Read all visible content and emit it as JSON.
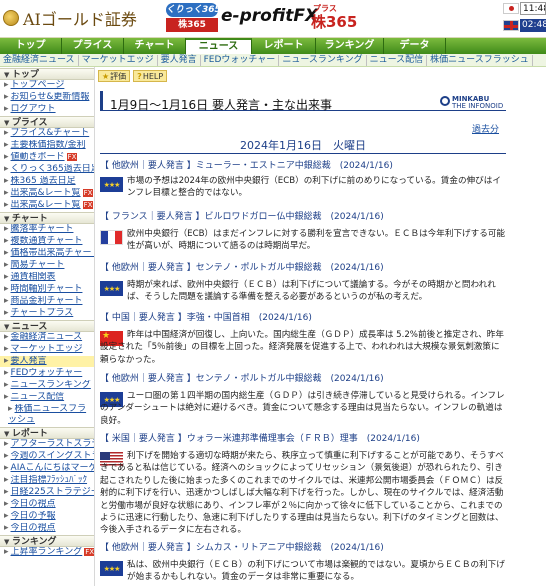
{
  "header": {
    "logo_text": "AIゴールド証券",
    "kurikku_top": "くりっく365",
    "kurikku_bottom": "株365",
    "eprofit": "e-profitFX",
    "plus": "プラス",
    "kabu365": "株365",
    "time_jp": "11:48:",
    "time_uk": "02:48:"
  },
  "nav": {
    "tabs": [
      {
        "label": "トップ"
      },
      {
        "label": "プライス"
      },
      {
        "label": "チャート"
      },
      {
        "label": "ニュース"
      },
      {
        "label": "レポート"
      },
      {
        "label": "ランキング"
      },
      {
        "label": "データ"
      }
    ],
    "active_index": 3
  },
  "subnav": [
    "金融経済ニュース",
    "マーケットエッジ",
    "要人発言",
    "FEDウォッチャー",
    "ニュースランキング",
    "ニュース配信",
    "株価ニュースフラッシュ"
  ],
  "sidebar": {
    "top_title": "トップ",
    "top_items": [
      "トップページ",
      "お知らせ&更新情報",
      "ログアウト"
    ],
    "price_title": "プライス",
    "price_items": [
      "プライス&チャート",
      "主要株価指数/金利",
      "値動きボード",
      "くりっく365過去日足",
      "株365 過去日足",
      "出来高&レート覧",
      "出来高&レート覧"
    ],
    "chart_title": "チャート",
    "chart_items": [
      "騰落率チャート",
      "複数通貨チャート",
      "価格帯出来高チャート",
      "簡易チャート",
      "通貨相関表",
      "時間軸別チャート",
      "商品金利チャート",
      "チャートプラス"
    ],
    "news_title": "ニュース",
    "news_items": [
      "金融経済ニュース",
      "マーケットエッジ",
      "要人発言",
      "FEDウォッチャー",
      "ニュースランキング",
      "ニュース配信",
      "株価ニュースフラッシュ"
    ],
    "report_title": "レポート",
    "report_items": [
      "アフターラストスラテジー",
      "今週のスイングストラテジー",
      "AIAこんにちはマーケット",
      "注目指標ﾌﾗｯｼｭﾊﾞｯｸ",
      "日経225ストラテジー",
      "今日の視点",
      "今日の予報",
      "今日の視点"
    ],
    "ranking_title": "ランキング",
    "ranking_items": [
      "上昇率ランキング"
    ],
    "fx_badge": "FX"
  },
  "main": {
    "rating_btn": "評価",
    "help_btn": "HELP",
    "page_title": "1月9日〜1月16日 要人発言・主な出来事",
    "minkabu_line1": "MINKABU",
    "minkabu_line2": "THE INFONOID",
    "past_link": "過去分",
    "date_heading": "2024年1月16日　火曜日",
    "articles": [
      {
        "head": "【 他欧州｜要人発言 】ミューラー・エストニア中銀総裁　(2024/1/16)",
        "body": "市場の予想は2024年の欧州中央銀行（ECB）の利下げに前のめりになっている。賃金の伸びはインフレ目標と整合的ではない。"
      },
      {
        "head": "【 フランス｜要人発言 】ビルロワドガロー仏中銀総裁　(2024/1/16)",
        "body": "欧州中央銀行（ECB）はまだインフレに対する勝利を宣言できない。ＥＣＢは今年利下げする可能性が高いが、時期について語るのは時期尚早だ。"
      },
      {
        "head": "【 他欧州｜要人発言 】センテノ・ポルトガル中銀総裁　(2024/1/16)",
        "body": "時期が来れば、欧州中央銀行（ＥＣＢ）は利下げについて議論する。今がその時期かと問われれば、そうした問題を議論する準備を整える必要があるというのが私の考えだ。"
      },
      {
        "head": "【 中国｜要人発言 】李強・中国首相　(2024/1/16)",
        "body": "昨年は中国経済が回復し、上向いた。国内総生産（ＧＤＰ）成長率は 5.2%前後と推定され、昨年設定された「5％前後」の目標を上回った。経済発展を促進する上で、われわれは大規模な景気刺激策に頼らなかった。"
      },
      {
        "head": "【 他欧州｜要人発言 】センテノ・ポルトガル中銀総裁　(2024/1/16)",
        "body": "ユーロ圏の第１四半期の国内総生産（ＧＤＰ）は引き続き停滞していると見受けられる。インフレのアンダーシュートは絶対に避けるべき。賃金について懸念する理由は見当たらない。インフレの軌道は良好。"
      },
      {
        "head": "【 米国｜要人発言 】ウォラー米連邦準備理事会（ＦＲＢ）理事　(2024/1/16)",
        "body": "利下げを開始する適切な時期が来たら、秩序立って慎重に利下げすることが可能であり、そうすべきであると私は信じている。経済へのショックによってリセッション（景気後退）が恐れられたり、引き起こされたりした後に始まった多くのこれまでのサイクルでは、米連邦公開市場委員会（ＦＯＭＣ）は反射的に利下げを行い、迅速かつしばしば大幅な利下げを行った。しかし、現在のサイクルでは、経済活動と労働市場が良好な状態にあり、インフレ率が２％に向かって徐々に低下していることから、これまでのように迅速に行動したり、急速に利下げしたりする理由は見当たらない。利下げのタイミングと回数は、今後入手されるデータに左右される。"
      },
      {
        "head": "【 他欧州｜要人発言 】シムカス・リトアニア中銀総裁　(2024/1/16)",
        "body": "私は、欧州中央銀行（ＥＣＢ）の利下げについて市場は楽観的ではない。夏頃からＥＣＢの利下げが始まるかもしれない。賃金のデータは非常に重要になる。"
      }
    ]
  }
}
